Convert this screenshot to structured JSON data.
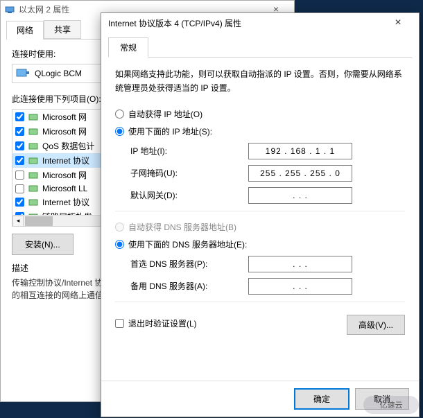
{
  "back": {
    "title": "以太网 2 属性",
    "tabs": [
      "网络",
      "共享"
    ],
    "connect_label": "连接时使用:",
    "adapter": "QLogic BCM",
    "items_label": "此连接使用下列项目(O):",
    "items": [
      {
        "checked": true,
        "label": "Microsoft 网"
      },
      {
        "checked": true,
        "label": "Microsoft 网"
      },
      {
        "checked": true,
        "label": "QoS 数据包计"
      },
      {
        "checked": true,
        "label": "Internet 协议",
        "selected": true
      },
      {
        "checked": false,
        "label": "Microsoft 网"
      },
      {
        "checked": false,
        "label": "Microsoft LL"
      },
      {
        "checked": true,
        "label": "Internet 协议"
      },
      {
        "checked": true,
        "label": "链路层拓扑发"
      }
    ],
    "install_btn": "安装(N)...",
    "desc_label": "描述",
    "desc_text": "传输控制协议/Internet 协议。该协议是默认的广域网络协议，用于在不同的相互连接的网络上通信。"
  },
  "front": {
    "title": "Internet 协议版本 4 (TCP/IPv4) 属性",
    "tab": "常规",
    "intro": "如果网络支持此功能，则可以获取自动指派的 IP 设置。否则，你需要从网络系统管理员处获得适当的 IP 设置。",
    "radio_auto_ip": "自动获得 IP 地址(O)",
    "radio_static_ip": "使用下面的 IP 地址(S):",
    "ip_label": "IP 地址(I):",
    "ip_value": "192 . 168 .   1   .   1",
    "mask_label": "子网掩码(U):",
    "mask_value": "255 . 255 . 255 .   0",
    "gw_label": "默认网关(D):",
    "gw_value": ".         .         .",
    "radio_auto_dns": "自动获得 DNS 服务器地址(B)",
    "radio_static_dns": "使用下面的 DNS 服务器地址(E):",
    "dns1_label": "首选 DNS 服务器(P):",
    "dns1_value": ".         .         .",
    "dns2_label": "备用 DNS 服务器(A):",
    "dns2_value": ".         .         .",
    "exit_validate": "退出时验证设置(L)",
    "adv_btn": "高级(V)...",
    "ok": "确定",
    "cancel": "取消"
  },
  "stamp": "亿速云"
}
